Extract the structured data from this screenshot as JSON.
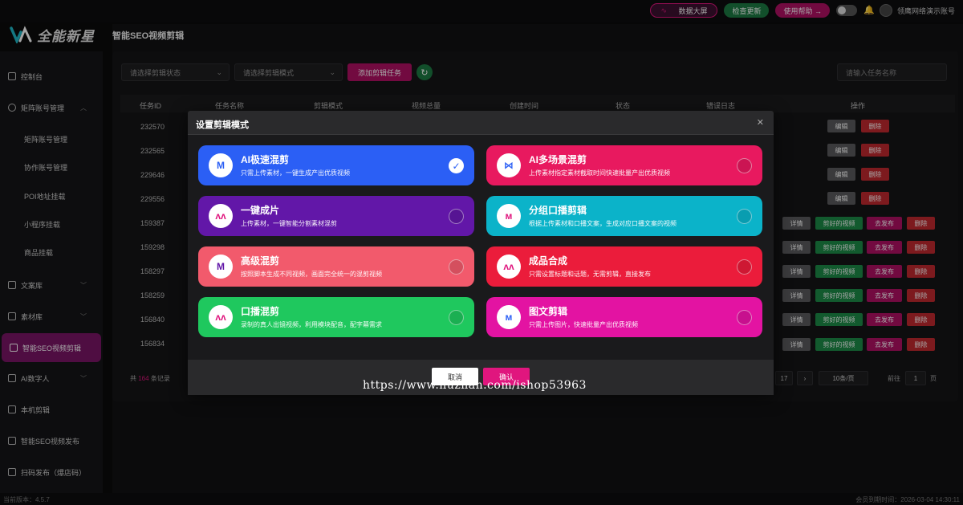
{
  "app": {
    "logo_text": "全能新星"
  },
  "topbar": {
    "dashboard_label": "数据大屏",
    "update_label": "检查更新",
    "help_label": "使用帮助 →",
    "account_name": "领鹰网络演示账号"
  },
  "sidebar": {
    "items": [
      {
        "label": "控制台"
      },
      {
        "label": "矩阵账号管理"
      },
      {
        "label": "矩阵账号管理"
      },
      {
        "label": "协作账号管理"
      },
      {
        "label": "POI地址挂载"
      },
      {
        "label": "小程序挂载"
      },
      {
        "label": "商品挂载"
      },
      {
        "label": "文案库"
      },
      {
        "label": "素材库"
      },
      {
        "label": "智能SEO视频剪辑"
      },
      {
        "label": "AI数字人"
      },
      {
        "label": "本机剪辑"
      },
      {
        "label": "智能SEO视频发布"
      },
      {
        "label": "扫码发布（爆店码）"
      }
    ]
  },
  "page": {
    "title": "智能SEO视频剪辑"
  },
  "filters": {
    "status_placeholder": "请选择剪辑状态",
    "mode_placeholder": "请选择剪辑模式",
    "add_label": "添加剪辑任务",
    "search_placeholder": "请输入任务名称"
  },
  "table": {
    "headers": [
      "任务ID",
      "任务名称",
      "剪辑模式",
      "视频总量",
      "创建时间",
      "状态",
      "错误日志",
      "操作"
    ],
    "rows": [
      "232570",
      "232565",
      "229646",
      "229556",
      "159387",
      "159298",
      "158297",
      "158259",
      "156840",
      "156834"
    ],
    "btn_edit": "编辑",
    "btn_delete": "删除",
    "btn_detail": "详情",
    "btn_good": "剪好的视频",
    "btn_publish": "去发布"
  },
  "pagination": {
    "total_prefix": "共",
    "total_count": "164",
    "total_suffix": "条记录",
    "current_page": "17",
    "next": "›",
    "page_size": "10条/页",
    "goto_prefix": "前往",
    "goto_value": "1",
    "goto_suffix": "页"
  },
  "status": {
    "version": "当前版本：4.5.7",
    "expiry": "会员到期时间：2026-03-04 14:30:11"
  },
  "modal": {
    "title": "设置剪辑模式",
    "cancel_label": "取消",
    "ok_label": "确认",
    "options": [
      {
        "title": "AI极速混剪",
        "desc": "只需上传素材，一键生成产出优质视频",
        "color": "#2b5ff5",
        "selected": true
      },
      {
        "title": "AI多场景混剪",
        "desc": "上传素材指定素材截取时间快速批量产出优质视频",
        "color": "#e8195f",
        "selected": false
      },
      {
        "title": "一键成片",
        "desc": "上传素材，一键智能分割素材混剪",
        "color": "#6217a8",
        "selected": false
      },
      {
        "title": "分组口播剪辑",
        "desc": "根据上传素材和口播文案，生成对应口播文案的视频",
        "color": "#0bb3c9",
        "selected": false
      },
      {
        "title": "高级混剪",
        "desc": "按照脚本生成不同视频，画面完全统一的混剪视频",
        "color": "#f25a6c",
        "selected": false
      },
      {
        "title": "成品合成",
        "desc": "只需设置标题和话题，无需剪辑，直接发布",
        "color": "#eb1c3b",
        "selected": false
      },
      {
        "title": "口播混剪",
        "desc": "录制的真人出镜视频，利用模块配音，配字幕需求",
        "color": "#1fc85e",
        "selected": false
      },
      {
        "title": "图文剪辑",
        "desc": "只需上传图片，快速批量产出优质视频",
        "color": "#e313a2",
        "selected": false
      }
    ]
  },
  "watermark": "https://www.huzhan.com/ishop53963"
}
